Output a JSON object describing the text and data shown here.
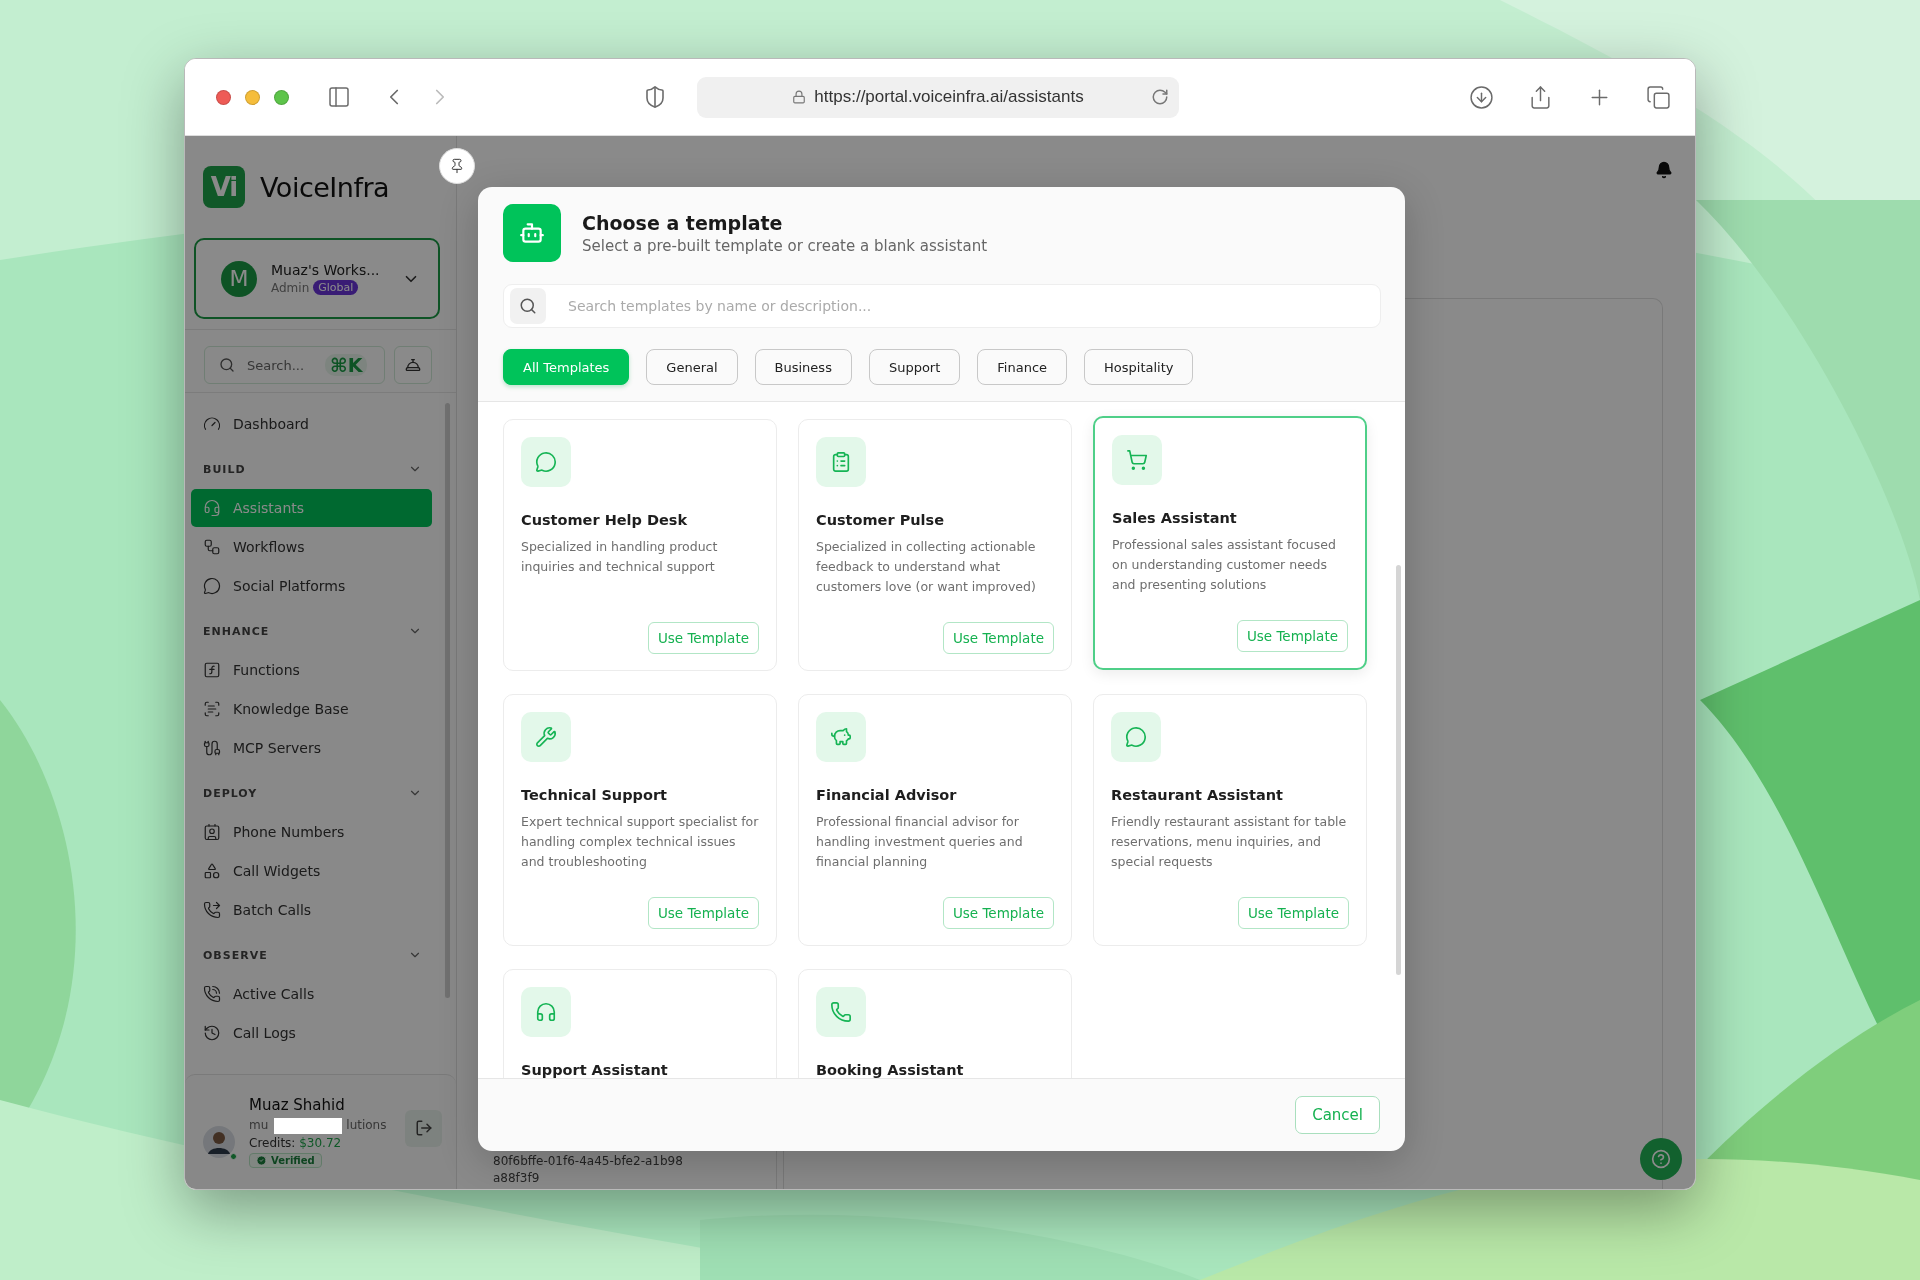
{
  "browser": {
    "url": "https://portal.voiceinfra.ai/assistants"
  },
  "sidebar": {
    "logo_mark": "Vi",
    "brand": "VoiceInfra",
    "workspace": {
      "avatar_letter": "M",
      "name": "Muaz's Works...",
      "role": "Admin",
      "badge": "Global"
    },
    "search": {
      "placeholder": "Search...",
      "shortcut": "⌘K"
    },
    "top_items": [
      {
        "label": "Dashboard",
        "selected": false
      }
    ],
    "sections": [
      {
        "title": "BUILD",
        "expanded": true,
        "items": [
          {
            "label": "Assistants",
            "selected": true
          },
          {
            "label": "Workflows",
            "selected": false
          },
          {
            "label": "Social Platforms",
            "selected": false
          }
        ]
      },
      {
        "title": "ENHANCE",
        "expanded": true,
        "items": [
          {
            "label": "Functions",
            "selected": false
          },
          {
            "label": "Knowledge Base",
            "selected": false
          },
          {
            "label": "MCP Servers",
            "selected": false
          }
        ]
      },
      {
        "title": "DEPLOY",
        "expanded": true,
        "items": [
          {
            "label": "Phone Numbers",
            "selected": false
          },
          {
            "label": "Call Widgets",
            "selected": false
          },
          {
            "label": "Batch Calls",
            "selected": false
          }
        ]
      },
      {
        "title": "OBSERVE",
        "expanded": true,
        "items": [
          {
            "label": "Active Calls",
            "selected": false
          },
          {
            "label": "Call Logs",
            "selected": false
          }
        ]
      }
    ],
    "user": {
      "name": "Muaz Shahid",
      "email_start": "mu",
      "email_end": "lutions",
      "credits_label": "Credits:",
      "credits": "$30.72",
      "verified": "Verified"
    }
  },
  "main": {
    "record_id": "80f6bffe-01f6-4a45-bfe2-a1b98a88f3f9"
  },
  "modal": {
    "title": "Choose a template",
    "subtitle": "Select a pre-built template or create a blank assistant",
    "search": {
      "placeholder": "Search templates by name or description..."
    },
    "filters": [
      {
        "label": "All Templates",
        "selected": true
      },
      {
        "label": "General",
        "selected": false
      },
      {
        "label": "Business",
        "selected": false
      },
      {
        "label": "Support",
        "selected": false
      },
      {
        "label": "Finance",
        "selected": false
      },
      {
        "label": "Hospitality",
        "selected": false
      }
    ],
    "cards": [
      {
        "title": "Customer Help Desk",
        "description": "Specialized in handling product inquiries and technical support",
        "button": "Use Template",
        "selected": false
      },
      {
        "title": "Customer Pulse",
        "description": "Specialized in collecting actionable feedback to understand what customers love (or want improved)",
        "button": "Use Template",
        "selected": false
      },
      {
        "title": "Sales Assistant",
        "description": "Professional sales assistant focused on understanding customer needs and presenting solutions",
        "button": "Use Template",
        "selected": true
      },
      {
        "title": "Technical Support",
        "description": "Expert technical support specialist for handling complex technical issues and troubleshooting",
        "button": "Use Template",
        "selected": false
      },
      {
        "title": "Financial Advisor",
        "description": "Professional financial advisor for handling investment queries and financial planning",
        "button": "Use Template",
        "selected": false
      },
      {
        "title": "Restaurant Assistant",
        "description": "Friendly restaurant assistant for table reservations, menu inquiries, and special requests",
        "button": "Use Template",
        "selected": false
      },
      {
        "title": "Support Assistant",
        "selected": false
      },
      {
        "title": "Booking Assistant",
        "selected": false
      }
    ],
    "cancel": "Cancel"
  }
}
